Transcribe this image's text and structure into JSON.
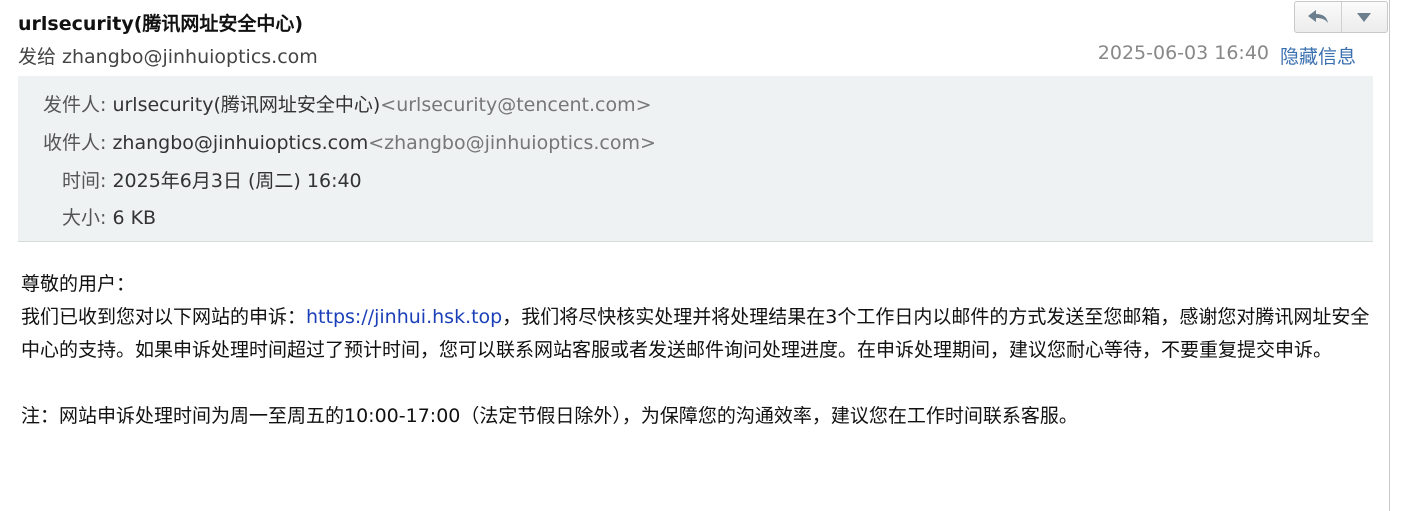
{
  "header": {
    "subject": "urlsecurity(腾讯网址安全中心)",
    "sendto_label": "发给",
    "sendto_address": "zhangbo@jinhuioptics.com",
    "datetime": "2025-06-03 16:40",
    "hide_details_label": "隐藏信息"
  },
  "details": {
    "from_label": "发件人:",
    "from_name": "urlsecurity(腾讯网址安全中心)",
    "from_email": "<urlsecurity@tencent.com>",
    "to_label": "收件人:",
    "to_name": "zhangbo@jinhuioptics.com",
    "to_email": "<zhangbo@jinhuioptics.com>",
    "time_label": "时间:",
    "time_value": "2025年6月3日 (周二) 16:40",
    "size_label": "大小:",
    "size_value": "6 KB"
  },
  "body": {
    "greeting": "尊敬的用户：",
    "para1_prefix": "我们已收到您对以下网站的申诉：",
    "link": "https://jinhui.hsk.top",
    "para1_suffix": "，我们将尽快核实处理并将处理结果在3个工作日内以邮件的方式发送至您邮箱，感谢您对腾讯网址安全中心的支持。如果申诉处理时间超过了预计时间，您可以联系网站客服或者发送邮件询问处理进度。在申诉处理期间，建议您耐心等待，不要重复提交申诉。",
    "note": "注：网站申诉处理时间为周一至周五的10:00-17:00（法定节假日除外），为保障您的沟通效率，建议您在工作时间联系客服。"
  },
  "icons": {
    "reply": "reply-icon",
    "more": "chevron-down-icon"
  }
}
